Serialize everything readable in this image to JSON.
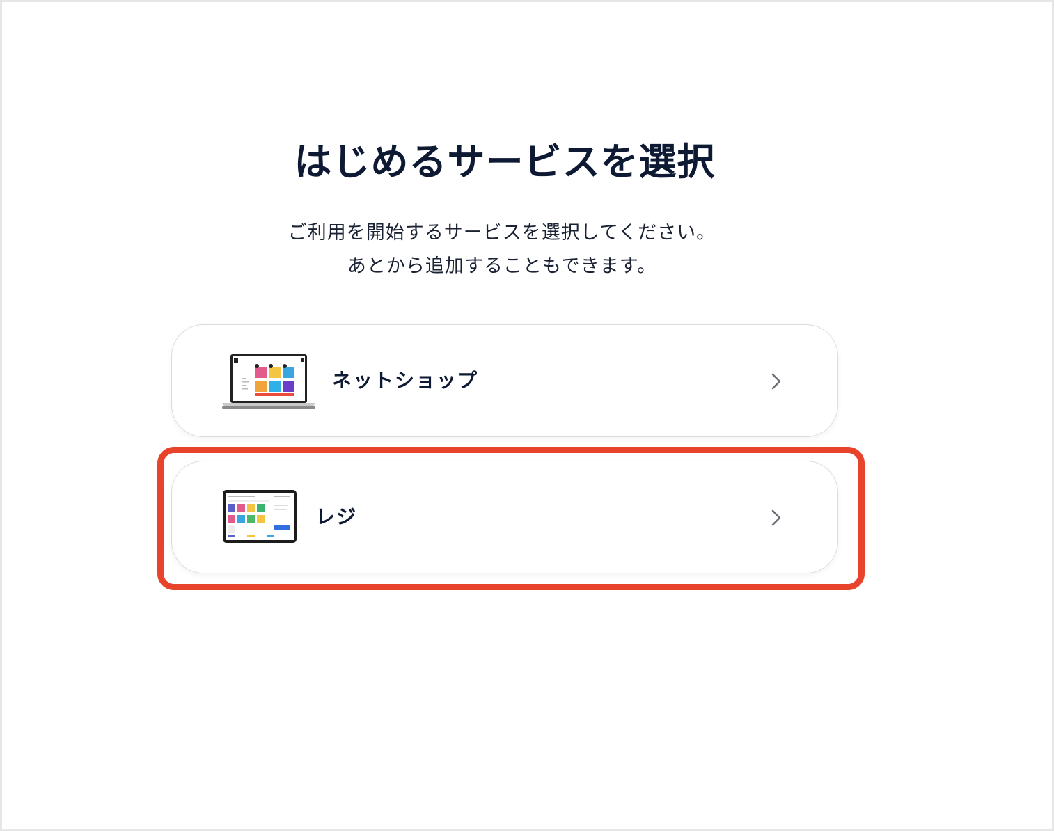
{
  "title": "はじめるサービスを選択",
  "description_line1": "ご利用を開始するサービスを選択してください。",
  "description_line2": "あとから追加することもできます。",
  "services": [
    {
      "label": "ネットショップ",
      "image": "laptop-shop-screenshot"
    },
    {
      "label": "レジ",
      "image": "tablet-pos-screenshot"
    }
  ],
  "icons": {
    "chevron": "chevron-right-icon"
  },
  "colors": {
    "highlight": "#e8432b",
    "text": "#0e1a33",
    "card_border": "#dcdcdc"
  }
}
